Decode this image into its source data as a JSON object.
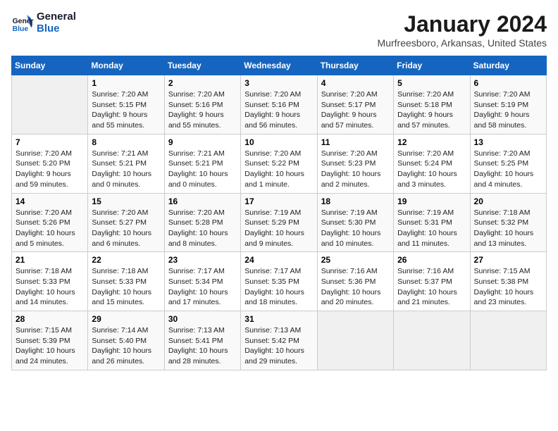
{
  "header": {
    "logo_line1": "General",
    "logo_line2": "Blue",
    "month_title": "January 2024",
    "location": "Murfreesboro, Arkansas, United States"
  },
  "weekdays": [
    "Sunday",
    "Monday",
    "Tuesday",
    "Wednesday",
    "Thursday",
    "Friday",
    "Saturday"
  ],
  "weeks": [
    [
      {
        "day": null
      },
      {
        "day": "1",
        "sunrise": "7:20 AM",
        "sunset": "5:15 PM",
        "daylight": "9 hours and 55 minutes."
      },
      {
        "day": "2",
        "sunrise": "7:20 AM",
        "sunset": "5:16 PM",
        "daylight": "9 hours and 55 minutes."
      },
      {
        "day": "3",
        "sunrise": "7:20 AM",
        "sunset": "5:16 PM",
        "daylight": "9 hours and 56 minutes."
      },
      {
        "day": "4",
        "sunrise": "7:20 AM",
        "sunset": "5:17 PM",
        "daylight": "9 hours and 57 minutes."
      },
      {
        "day": "5",
        "sunrise": "7:20 AM",
        "sunset": "5:18 PM",
        "daylight": "9 hours and 57 minutes."
      },
      {
        "day": "6",
        "sunrise": "7:20 AM",
        "sunset": "5:19 PM",
        "daylight": "9 hours and 58 minutes."
      }
    ],
    [
      {
        "day": "7",
        "sunrise": "7:20 AM",
        "sunset": "5:20 PM",
        "daylight": "9 hours and 59 minutes."
      },
      {
        "day": "8",
        "sunrise": "7:21 AM",
        "sunset": "5:21 PM",
        "daylight": "10 hours and 0 minutes."
      },
      {
        "day": "9",
        "sunrise": "7:21 AM",
        "sunset": "5:21 PM",
        "daylight": "10 hours and 0 minutes."
      },
      {
        "day": "10",
        "sunrise": "7:20 AM",
        "sunset": "5:22 PM",
        "daylight": "10 hours and 1 minute."
      },
      {
        "day": "11",
        "sunrise": "7:20 AM",
        "sunset": "5:23 PM",
        "daylight": "10 hours and 2 minutes."
      },
      {
        "day": "12",
        "sunrise": "7:20 AM",
        "sunset": "5:24 PM",
        "daylight": "10 hours and 3 minutes."
      },
      {
        "day": "13",
        "sunrise": "7:20 AM",
        "sunset": "5:25 PM",
        "daylight": "10 hours and 4 minutes."
      }
    ],
    [
      {
        "day": "14",
        "sunrise": "7:20 AM",
        "sunset": "5:26 PM",
        "daylight": "10 hours and 5 minutes."
      },
      {
        "day": "15",
        "sunrise": "7:20 AM",
        "sunset": "5:27 PM",
        "daylight": "10 hours and 6 minutes."
      },
      {
        "day": "16",
        "sunrise": "7:20 AM",
        "sunset": "5:28 PM",
        "daylight": "10 hours and 8 minutes."
      },
      {
        "day": "17",
        "sunrise": "7:19 AM",
        "sunset": "5:29 PM",
        "daylight": "10 hours and 9 minutes."
      },
      {
        "day": "18",
        "sunrise": "7:19 AM",
        "sunset": "5:30 PM",
        "daylight": "10 hours and 10 minutes."
      },
      {
        "day": "19",
        "sunrise": "7:19 AM",
        "sunset": "5:31 PM",
        "daylight": "10 hours and 11 minutes."
      },
      {
        "day": "20",
        "sunrise": "7:18 AM",
        "sunset": "5:32 PM",
        "daylight": "10 hours and 13 minutes."
      }
    ],
    [
      {
        "day": "21",
        "sunrise": "7:18 AM",
        "sunset": "5:33 PM",
        "daylight": "10 hours and 14 minutes."
      },
      {
        "day": "22",
        "sunrise": "7:18 AM",
        "sunset": "5:33 PM",
        "daylight": "10 hours and 15 minutes."
      },
      {
        "day": "23",
        "sunrise": "7:17 AM",
        "sunset": "5:34 PM",
        "daylight": "10 hours and 17 minutes."
      },
      {
        "day": "24",
        "sunrise": "7:17 AM",
        "sunset": "5:35 PM",
        "daylight": "10 hours and 18 minutes."
      },
      {
        "day": "25",
        "sunrise": "7:16 AM",
        "sunset": "5:36 PM",
        "daylight": "10 hours and 20 minutes."
      },
      {
        "day": "26",
        "sunrise": "7:16 AM",
        "sunset": "5:37 PM",
        "daylight": "10 hours and 21 minutes."
      },
      {
        "day": "27",
        "sunrise": "7:15 AM",
        "sunset": "5:38 PM",
        "daylight": "10 hours and 23 minutes."
      }
    ],
    [
      {
        "day": "28",
        "sunrise": "7:15 AM",
        "sunset": "5:39 PM",
        "daylight": "10 hours and 24 minutes."
      },
      {
        "day": "29",
        "sunrise": "7:14 AM",
        "sunset": "5:40 PM",
        "daylight": "10 hours and 26 minutes."
      },
      {
        "day": "30",
        "sunrise": "7:13 AM",
        "sunset": "5:41 PM",
        "daylight": "10 hours and 28 minutes."
      },
      {
        "day": "31",
        "sunrise": "7:13 AM",
        "sunset": "5:42 PM",
        "daylight": "10 hours and 29 minutes."
      },
      {
        "day": null
      },
      {
        "day": null
      },
      {
        "day": null
      }
    ]
  ]
}
